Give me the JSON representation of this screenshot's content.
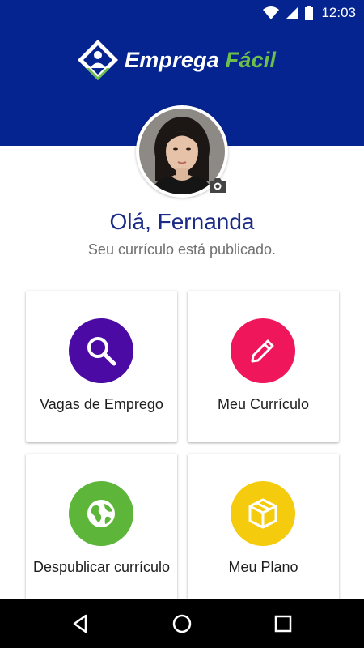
{
  "status_bar": {
    "time": "12:03",
    "icons": [
      "wifi-icon",
      "signal-icon",
      "battery-icon"
    ]
  },
  "app": {
    "logo_word1": "Emprega",
    "logo_word2": "Fácil",
    "brand_color": "#06248f",
    "accent_color": "#6cc04a"
  },
  "profile": {
    "greeting": "Olá, Fernanda",
    "status_text": "Seu currículo está publicado.",
    "camera_icon": "camera-icon"
  },
  "menu": [
    {
      "label": "Vagas de Emprego",
      "icon": "search-icon",
      "color": "#4a0aa3"
    },
    {
      "label": "Meu Currículo",
      "icon": "pencil-icon",
      "color": "#f0165c"
    },
    {
      "label": "Despublicar currículo",
      "icon": "globe-icon",
      "color": "#5db53a"
    },
    {
      "label": "Meu Plano",
      "icon": "box-icon",
      "color": "#f5cb0e"
    }
  ],
  "nav_bar": [
    "back-icon",
    "home-icon",
    "recents-icon"
  ]
}
